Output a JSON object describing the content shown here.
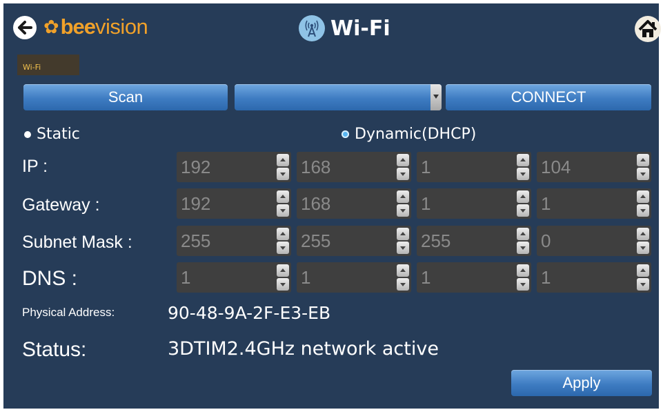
{
  "header": {
    "logo": {
      "bee": "bee",
      "vision": "vision"
    },
    "title": "Wi-Fi",
    "back_icon": "arrow-left-icon",
    "title_icon": "wifi-antenna-icon",
    "home_icon": "home-icon"
  },
  "tab": {
    "label": "Wi-Fi"
  },
  "toolbar": {
    "scan_label": "Scan",
    "network_select_value": "",
    "connect_label": "CONNECT"
  },
  "mode": {
    "static_label": "Static",
    "dhcp_label": "Dynamic(DHCP)",
    "selected": "Dynamic(DHCP)"
  },
  "fields": {
    "ip": {
      "label": "IP :",
      "values": [
        "192",
        "168",
        "1",
        "104"
      ]
    },
    "gateway": {
      "label": "Gateway :",
      "values": [
        "192",
        "168",
        "1",
        "1"
      ]
    },
    "subnet": {
      "label": "Subnet Mask :",
      "values": [
        "255",
        "255",
        "255",
        "0"
      ]
    },
    "dns": {
      "label": "DNS :",
      "values": [
        "1",
        "1",
        "1",
        "1"
      ]
    }
  },
  "info": {
    "physical_label": "Physical Address:",
    "physical_value": "90-48-9A-2F-E3-EB",
    "status_label": "Status:",
    "status_value": "3DTIM2.4GHz network active"
  },
  "footer": {
    "apply_label": "Apply"
  },
  "colors": {
    "background": "#263c58",
    "accent": "#f0a12a",
    "button": "#3e7cc2"
  }
}
